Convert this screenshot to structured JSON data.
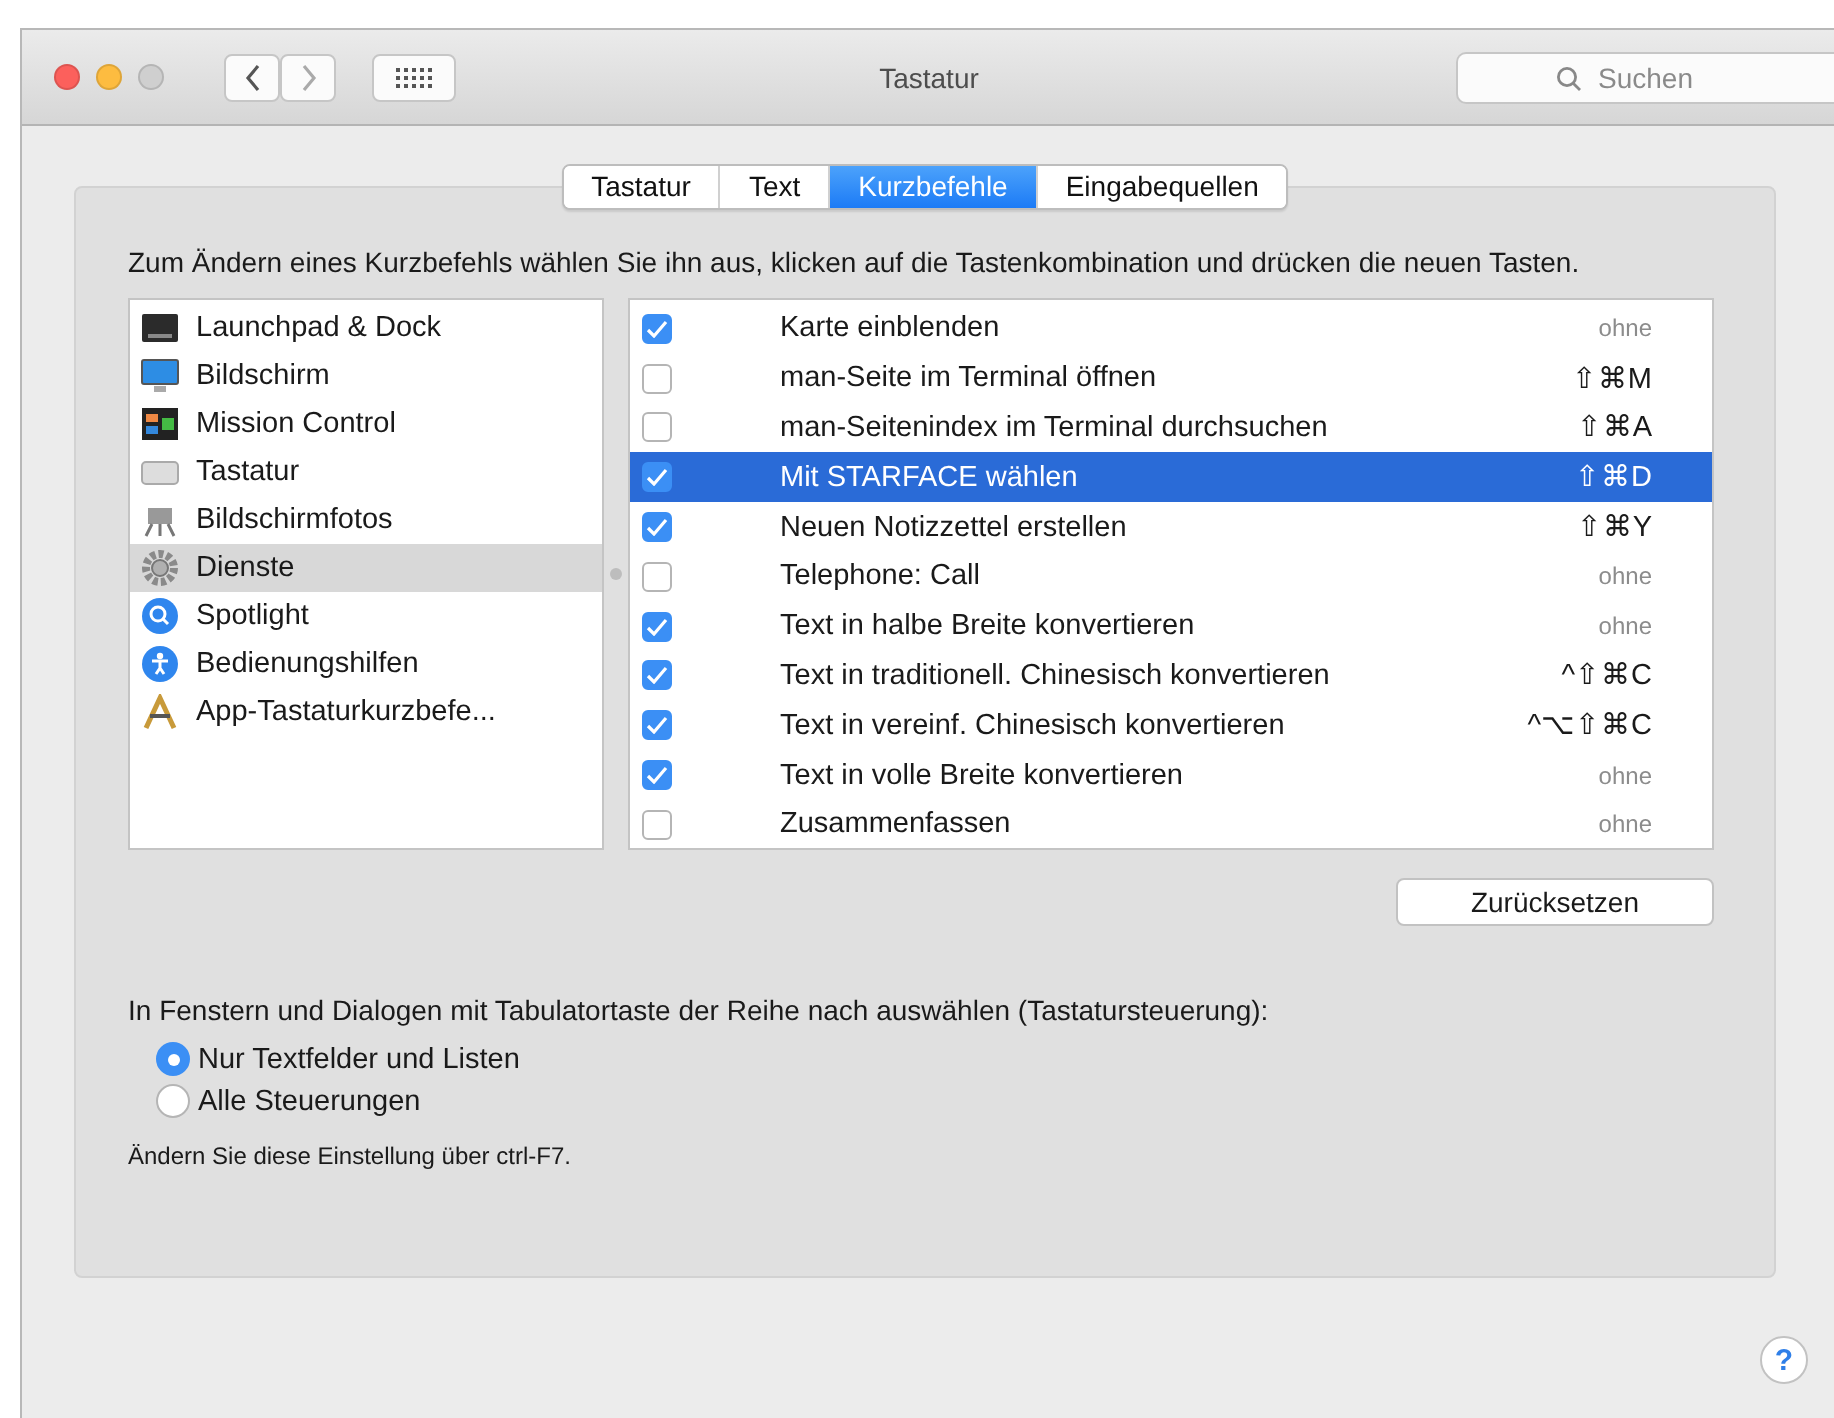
{
  "window": {
    "title": "Tastatur",
    "search_placeholder": "Suchen"
  },
  "tabs": [
    {
      "label": "Tastatur",
      "selected": false
    },
    {
      "label": "Text",
      "selected": false
    },
    {
      "label": "Kurzbefehle",
      "selected": true
    },
    {
      "label": "Eingabequellen",
      "selected": false
    }
  ],
  "instructions": "Zum Ändern eines Kurzbefehls wählen Sie ihn aus, klicken auf die Tastenkombination und drücken die neuen Tasten.",
  "categories": [
    {
      "label": "Launchpad & Dock",
      "kind": "dock",
      "selected": false
    },
    {
      "label": "Bildschirm",
      "kind": "display",
      "selected": false
    },
    {
      "label": "Mission Control",
      "kind": "mission",
      "selected": false
    },
    {
      "label": "Tastatur",
      "kind": "keyboard",
      "selected": false
    },
    {
      "label": "Bildschirmfotos",
      "kind": "screenshot",
      "selected": false
    },
    {
      "label": "Dienste",
      "kind": "gear",
      "selected": true
    },
    {
      "label": "Spotlight",
      "kind": "search",
      "selected": false
    },
    {
      "label": "Bedienungshilfen",
      "kind": "accessibility",
      "selected": false
    },
    {
      "label": "App-Tastaturkurzbefe...",
      "kind": "app",
      "selected": false
    }
  ],
  "shortcuts": [
    {
      "label": "Karte einblenden",
      "checked": true,
      "selected": false,
      "keys": "ohne",
      "assigned": false
    },
    {
      "label": "man-Seite im Terminal öffnen",
      "checked": false,
      "selected": false,
      "keys": "⇧⌘M",
      "assigned": true
    },
    {
      "label": "man-Seitenindex im Terminal durchsuchen",
      "checked": false,
      "selected": false,
      "keys": "⇧⌘A",
      "assigned": true
    },
    {
      "label": "Mit STARFACE wählen",
      "checked": true,
      "selected": true,
      "keys": "⇧⌘D",
      "assigned": true
    },
    {
      "label": "Neuen Notizzettel erstellen",
      "checked": true,
      "selected": false,
      "keys": "⇧⌘Y",
      "assigned": true
    },
    {
      "label": "Telephone: Call",
      "checked": false,
      "selected": false,
      "keys": "ohne",
      "assigned": false
    },
    {
      "label": "Text in halbe Breite konvertieren",
      "checked": true,
      "selected": false,
      "keys": "ohne",
      "assigned": false
    },
    {
      "label": "Text in traditionell. Chinesisch konvertieren",
      "checked": true,
      "selected": false,
      "keys": "^⇧⌘C",
      "assigned": true
    },
    {
      "label": "Text in vereinf. Chinesisch konvertieren",
      "checked": true,
      "selected": false,
      "keys": "^⌥⇧⌘C",
      "assigned": true
    },
    {
      "label": "Text in volle Breite konvertieren",
      "checked": true,
      "selected": false,
      "keys": "ohne",
      "assigned": false
    },
    {
      "label": "Zusammenfassen",
      "checked": false,
      "selected": false,
      "keys": "ohne",
      "assigned": false
    }
  ],
  "reset_button": "Zurücksetzen",
  "tab_navigation": {
    "label": "In Fenstern und Dialogen mit Tabulatortaste der Reihe nach auswählen (Tastatursteuerung):",
    "options": [
      {
        "label": "Nur Textfelder und Listen",
        "selected": true
      },
      {
        "label": "Alle Steuerungen",
        "selected": false
      }
    ],
    "hint": "Ändern Sie diese Einstellung über ctrl-F7."
  },
  "help_button": "?"
}
